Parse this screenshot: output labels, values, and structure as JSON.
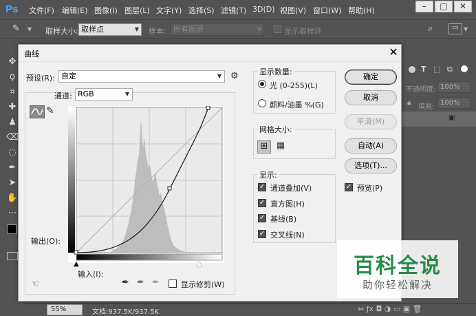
{
  "menubar": {
    "logo": "Ps",
    "items": [
      "文件(F)",
      "编辑(E)",
      "图像(I)",
      "图层(L)",
      "文字(Y)",
      "选择(S)",
      "滤镜(T)",
      "3D(D)",
      "视图(V)",
      "窗口(W)",
      "帮助(H)"
    ]
  },
  "options": {
    "sample_size_label": "取样大小:",
    "sample_size_value": "取样点",
    "sample_label": "样本:",
    "sample_value": "所有图层",
    "show_ring_label": "显示取样环"
  },
  "right_panel": {
    "opacity_label": "不透明度:",
    "opacity_value": "100%",
    "fill_label": "填充:",
    "fill_value": "100%"
  },
  "status": {
    "zoom": "55%",
    "doc": "文档:937.5K/937.5K"
  },
  "dialog": {
    "title": "曲线",
    "preset_label": "预设(R):",
    "preset_value": "自定",
    "channel_label": "通道:",
    "channel_value": "RGB",
    "output_label": "输出(O):",
    "input_label": "输入(I):",
    "show_clipping_label": "显示修剪(W)",
    "display_amount": {
      "title": "显示数量:",
      "light": "光 (0-255)(L)",
      "pigment": "颜料/油墨 %(G)"
    },
    "grid_size": {
      "title": "网格大小:"
    },
    "show": {
      "title": "显示:",
      "channel_overlay": "通道叠加(V)",
      "histogram": "直方图(H)",
      "baseline": "基线(B)",
      "intersection": "交叉线(N)"
    },
    "buttons": {
      "ok": "确定",
      "cancel": "取消",
      "smooth": "平滑(M)",
      "auto": "自动(A)",
      "options": "选项(T)..."
    },
    "preview_label": "预览(P)"
  },
  "watermark": {
    "main": "百科全说",
    "sub": "助你轻松解决"
  },
  "colors": {
    "ps_bg": "#535353",
    "dialog_bg": "#f0f0f0",
    "histogram": "#bdbdbd",
    "ps_blue": "#4ea5ff"
  }
}
